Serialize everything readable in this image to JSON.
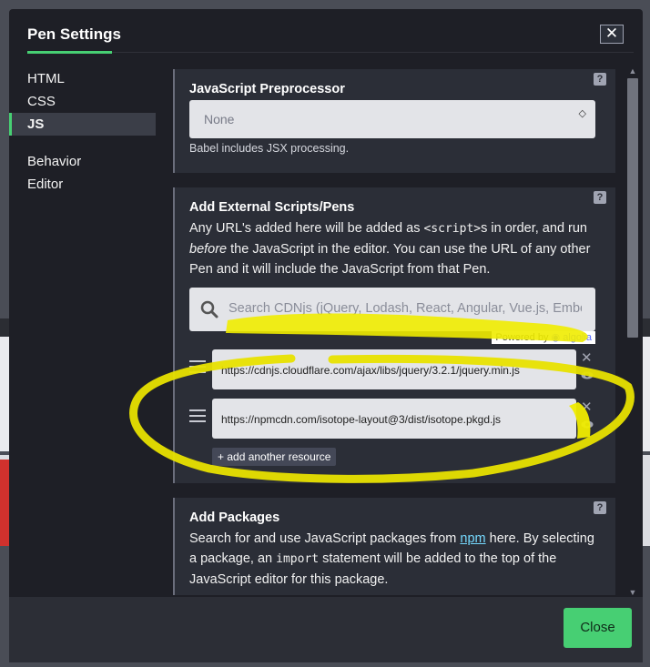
{
  "modal": {
    "title": "Pen Settings",
    "close_icon": "close-icon"
  },
  "nav": {
    "items": [
      {
        "label": "HTML",
        "active": false
      },
      {
        "label": "CSS",
        "active": false
      },
      {
        "label": "JS",
        "active": true
      },
      {
        "label": "Behavior",
        "active": false
      },
      {
        "label": "Editor",
        "active": false
      }
    ]
  },
  "preprocessor": {
    "heading": "JavaScript Preprocessor",
    "selected": "None",
    "hint": "Babel includes JSX processing."
  },
  "external": {
    "heading": "Add External Scripts/Pens",
    "desc_part1": "Any URL's added here will be added as ",
    "desc_code": "<script>",
    "desc_part2": "s in order, and run ",
    "desc_em": "before",
    "desc_part3": " the JavaScript in the editor. You can use the URL of any other Pen and it will include the JavaScript from that Pen.",
    "search_placeholder": "Search CDNjs (jQuery, Lodash, React, Angular, Vue.js, Ember...",
    "powered_by": "Powered by",
    "algolia": "algolia",
    "resources": [
      "https://cdnjs.cloudflare.com/ajax/libs/jquery/3.2.1/jquery.min.js",
      "https://npmcdn.com/isotope-layout@3/dist/isotope.pkgd.js"
    ],
    "add_label": "+ add another resource"
  },
  "packages": {
    "heading": "Add Packages",
    "desc_part1": "Search for and use JavaScript packages from ",
    "desc_link": "npm",
    "desc_part2": " here. By selecting a package, an ",
    "desc_code": "import",
    "desc_part3": " statement will be added to the top of the JavaScript editor for this package."
  },
  "help_label": "?",
  "footer": {
    "close_label": "Close"
  },
  "colors": {
    "accent": "#47cf73",
    "annotation": "#f0ec00"
  }
}
